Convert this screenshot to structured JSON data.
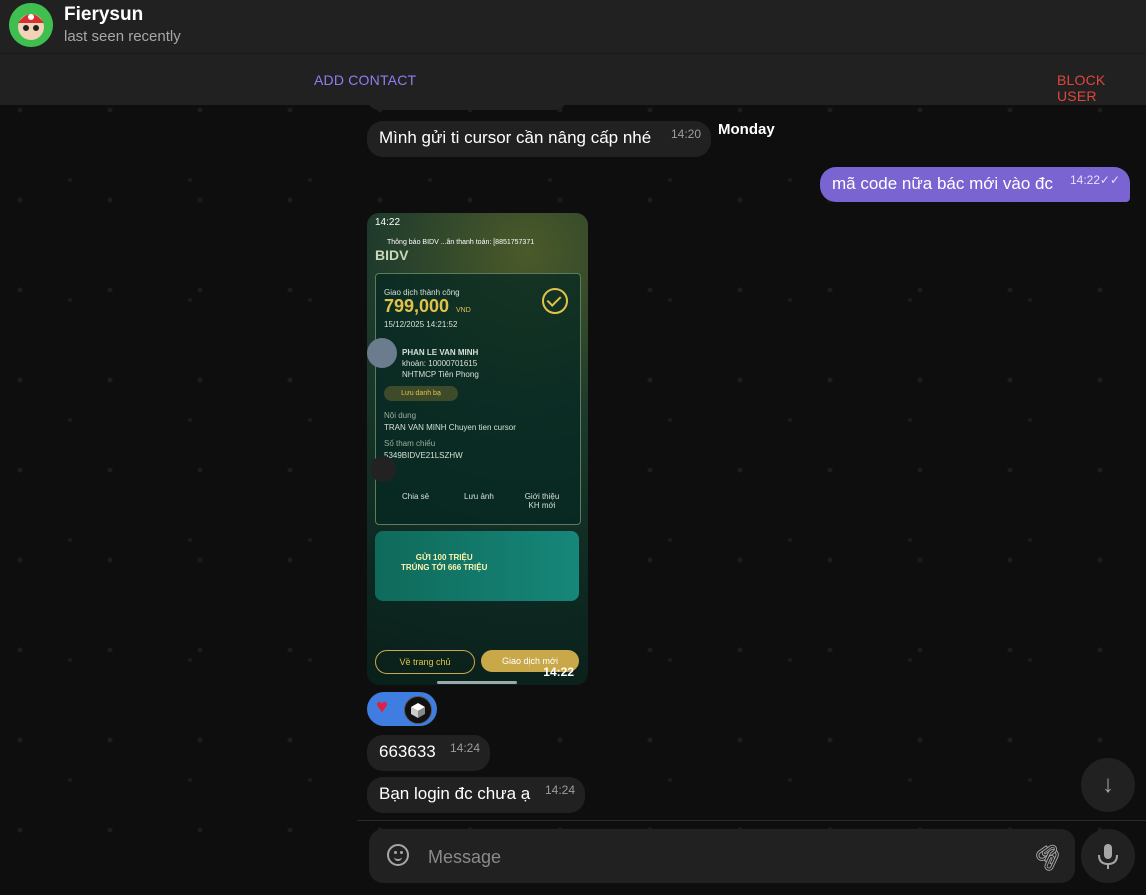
{
  "header": {
    "title": "Fierysun",
    "subtitle": "last seen recently"
  },
  "actions": {
    "add_contact": "ADD CONTACT",
    "block_user": "BLOCK USER"
  },
  "date_separator": "Monday",
  "messages": [
    {
      "text": "Mình gửi ti cursor cần nâng cấp nhé",
      "time": "14:20",
      "direction": "in"
    },
    {
      "text": "mã code nữa bác mới vào đc",
      "time": "14:22",
      "direction": "out",
      "ticks": "✓✓"
    },
    {
      "text": "663633",
      "time": "14:24",
      "direction": "in"
    },
    {
      "text": "Bạn login đc chưa ạ",
      "time": "14:24",
      "direction": "in"
    }
  ],
  "photo": {
    "time": "14:22",
    "status_time": "14:22",
    "notif": "Thông báo BIDV ...ân thanh toán: [8851757371",
    "brand": "BIDV",
    "tx_status": "Giao dịch thành công",
    "amount": "799,000",
    "currency": "VND",
    "datetime": "15/12/2025 14:21:52",
    "receiver_name": "PHAN LE VAN MINH",
    "account": "khoản: 10000701615",
    "bank": "NHTMCP Tiên Phong",
    "save_contact": "Lưu danh bạ",
    "content_label": "Nội dung",
    "content": "TRAN VAN MINH Chuyen tien cursor",
    "ref_label": "Số tham chiếu",
    "ref": "5349BIDVE21LSZHW",
    "action_share": "Chia sẻ",
    "action_save": "Lưu ảnh",
    "action_invite": "Giới thiệu KH mới",
    "banner_line1": "GỬI 100 TRIỆU",
    "banner_line2": "TRÚNG TỚI 666 TRIỆU",
    "btn_home": "Về trang chủ",
    "btn_new": "Giao dịch mới"
  },
  "reactions": {
    "heart": "♥"
  },
  "composer": {
    "placeholder": "Message"
  },
  "colors": {
    "accent": "#8e7ff0",
    "outgoing_bubble": "#7a64d1",
    "danger": "#e0463e",
    "panel": "#212121"
  }
}
